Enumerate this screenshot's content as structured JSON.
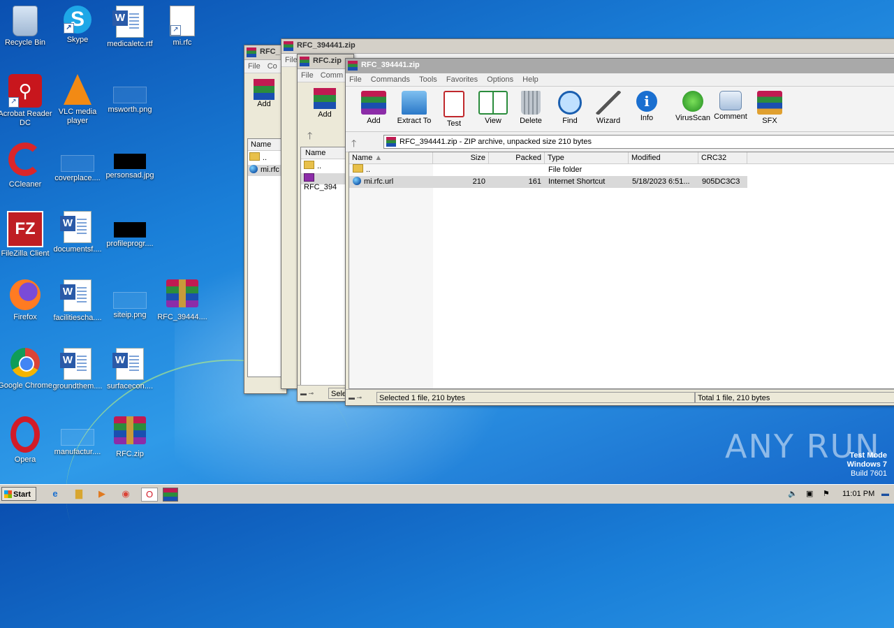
{
  "desktop": {
    "icons": [
      {
        "label": "Recycle Bin",
        "icon": "recycle-bin-icon"
      },
      {
        "label": "Skype",
        "icon": "skype-icon"
      },
      {
        "label": "medicaletc.rtf",
        "icon": "word-document-icon"
      },
      {
        "label": "mi.rfc",
        "icon": "blank-file-icon"
      },
      {
        "label": "Acrobat Reader DC",
        "icon": "acrobat-icon"
      },
      {
        "label": "VLC media player",
        "icon": "vlc-icon"
      },
      {
        "label": "msworth.png",
        "icon": "image-file-icon"
      },
      {
        "label": "CCleaner",
        "icon": "ccleaner-icon"
      },
      {
        "label": "coverplace....",
        "icon": "image-file-icon"
      },
      {
        "label": "personsad.jpg",
        "icon": "image-file-icon"
      },
      {
        "label": "FileZilla Client",
        "icon": "filezilla-icon"
      },
      {
        "label": "documentsf....",
        "icon": "word-document-icon"
      },
      {
        "label": "profileprogr....",
        "icon": "image-file-icon"
      },
      {
        "label": "Firefox",
        "icon": "firefox-icon"
      },
      {
        "label": "facilitiescha....",
        "icon": "word-document-icon"
      },
      {
        "label": "siteip.png",
        "icon": "image-file-icon"
      },
      {
        "label": "RFC_39444....",
        "icon": "winrar-archive-icon"
      },
      {
        "label": "Google Chrome",
        "icon": "chrome-icon"
      },
      {
        "label": "groundthem....",
        "icon": "word-document-icon"
      },
      {
        "label": "surfacecon....",
        "icon": "word-document-icon"
      },
      {
        "label": "Opera",
        "icon": "opera-icon"
      },
      {
        "label": "manufactur....",
        "icon": "image-file-icon"
      },
      {
        "label": "RFC.zip",
        "icon": "winrar-archive-icon"
      }
    ]
  },
  "back_windows": {
    "w1": {
      "title": "RFC_",
      "menu": [
        "File",
        "Co"
      ],
      "add": "Add",
      "col": "Name",
      "rows": [
        "..",
        "mi.rfc"
      ]
    },
    "w2": {
      "title": "RFC_394441.zip",
      "menu": [
        "File"
      ]
    },
    "w3": {
      "title": "RFC.zip",
      "menu": [
        "File",
        "Comm"
      ],
      "add": "Add",
      "col": "Name",
      "rows": [
        "..",
        "RFC_394"
      ],
      "status": "Sele"
    }
  },
  "main": {
    "title": "RFC_394441.zip",
    "menu": [
      "File",
      "Commands",
      "Tools",
      "Favorites",
      "Options",
      "Help"
    ],
    "toolbar": [
      "Add",
      "Extract To",
      "Test",
      "View",
      "Delete",
      "Find",
      "Wizard",
      "Info",
      "VirusScan",
      "Comment",
      "SFX"
    ],
    "address": "RFC_394441.zip - ZIP archive, unpacked size 210 bytes",
    "columns": [
      "Name",
      "Size",
      "Packed",
      "Type",
      "Modified",
      "CRC32"
    ],
    "rows": [
      {
        "name": "..",
        "size": "",
        "packed": "",
        "type": "File folder",
        "modified": "",
        "crc": ""
      },
      {
        "name": "mi.rfc.url",
        "size": "210",
        "packed": "161",
        "type": "Internet Shortcut",
        "modified": "5/18/2023 6:51...",
        "crc": "905DC3C3"
      }
    ],
    "status_left": "Selected 1 file, 210 bytes",
    "status_right": "Total 1 file, 210 bytes"
  },
  "taskbar": {
    "start": "Start",
    "time": "11:01 PM"
  },
  "watermark": {
    "line1": "Test Mode",
    "line2": "Windows 7",
    "line3": "Build 7601",
    "brand": "ANY RUN"
  }
}
